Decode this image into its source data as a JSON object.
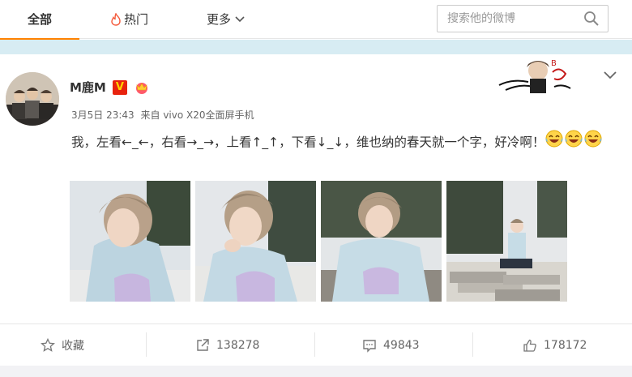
{
  "tabs": [
    {
      "label": "全部",
      "active": true
    },
    {
      "label": "热门",
      "icon": "fire-icon"
    },
    {
      "label": "更多",
      "icon": "chevron-down-icon"
    }
  ],
  "search": {
    "placeholder": "搜索他的微博",
    "icon": "search-icon"
  },
  "post": {
    "author": "M鹿M",
    "verified_badge": "V",
    "time": "3月5日 23:43",
    "source": "来自 vivo X20全面屏手机",
    "text": "我，左看←_←，右看→_→，上看↑_↑，下看↓_↓，维也纳的春天就一个字，好冷啊！",
    "emoji": [
      "laughing-tears-emoji",
      "laughing-tears-emoji",
      "laughing-tears-emoji"
    ],
    "photos": [
      "photo-1",
      "photo-2",
      "photo-3",
      "photo-4"
    ]
  },
  "actions": {
    "favorite": "收藏",
    "repost_count": "138278",
    "comment_count": "49843",
    "like_count": "178172"
  },
  "colors": {
    "accent": "#ff8200",
    "band": "#d7ecf3",
    "badge_red": "#e8230e"
  }
}
